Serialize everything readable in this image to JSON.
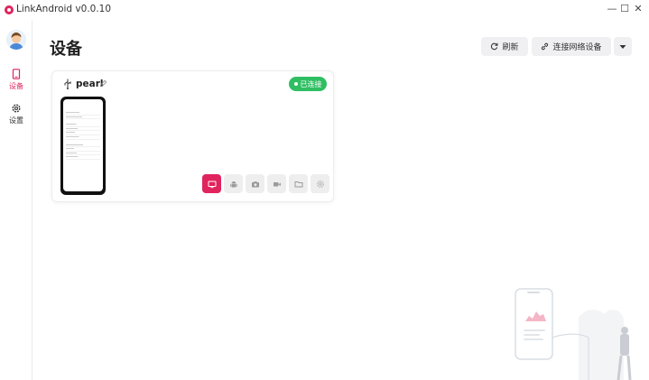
{
  "app": {
    "title": "LinkAndroid v0.0.10"
  },
  "window_controls": {
    "minimize": "—",
    "maximize": "☐",
    "close": "✕"
  },
  "sidebar": {
    "items": [
      {
        "label": "设备",
        "icon": "device-icon",
        "active": true
      },
      {
        "label": "设置",
        "icon": "gear-icon",
        "active": false
      }
    ]
  },
  "header": {
    "title": "设备",
    "refresh_label": "刷新",
    "connect_label": "连接网络设备",
    "more_icon": "caret-down-icon"
  },
  "device": {
    "name": "pearl",
    "status": "已连接",
    "status_color": "#2fbe62",
    "tools": [
      "screen-mirror-icon",
      "android-icon",
      "camera-icon",
      "video-icon",
      "folder-icon",
      "settings-icon"
    ],
    "active_tool_color": "#e0245e"
  },
  "colors": {
    "accent": "#e0245e",
    "success": "#2fbe62"
  }
}
